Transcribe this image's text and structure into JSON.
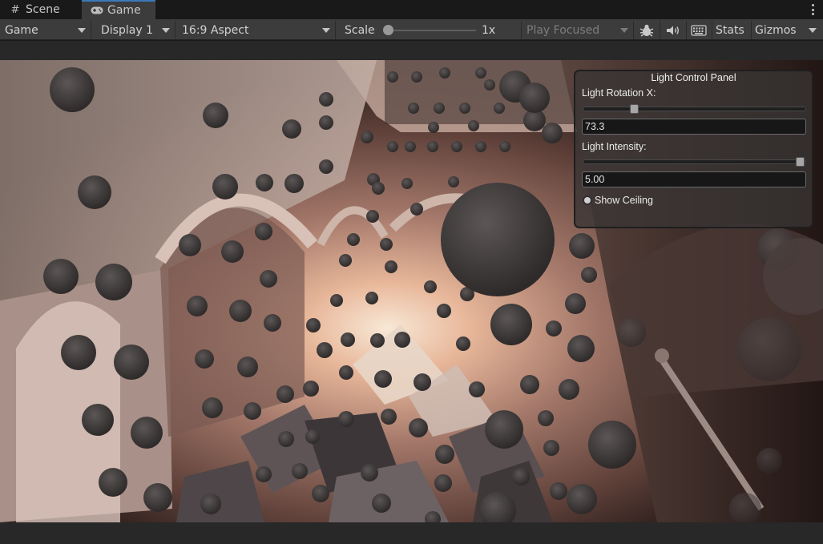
{
  "tabs": [
    {
      "label": "Scene",
      "icon": "hash-icon",
      "active": false
    },
    {
      "label": "Game",
      "icon": "gamepad-icon",
      "active": true
    }
  ],
  "toolbar": {
    "display_mode": "Game",
    "display": "Display 1",
    "aspect": "16:9 Aspect",
    "scale_label": "Scale",
    "scale_value": "1x",
    "scale_fraction": 0.0,
    "play_mode": "Play Focused",
    "stats_label": "Stats",
    "gizmos_label": "Gizmos",
    "icons": [
      "bug-icon",
      "speaker-icon",
      "keyboard-icon"
    ]
  },
  "light_panel": {
    "title": "Light Control Panel",
    "rotation_label": "Light Rotation X:",
    "rotation_value": "73.3",
    "rotation_fraction": 0.22,
    "intensity_label": "Light Intensity:",
    "intensity_value": "5.00",
    "intensity_fraction": 1.0,
    "show_ceiling_label": "Show Ceiling",
    "show_ceiling_on": true
  },
  "colors": {
    "accent": "#3a79bb",
    "panel_bg": "#3c3c3c",
    "window_bg": "#191919"
  }
}
